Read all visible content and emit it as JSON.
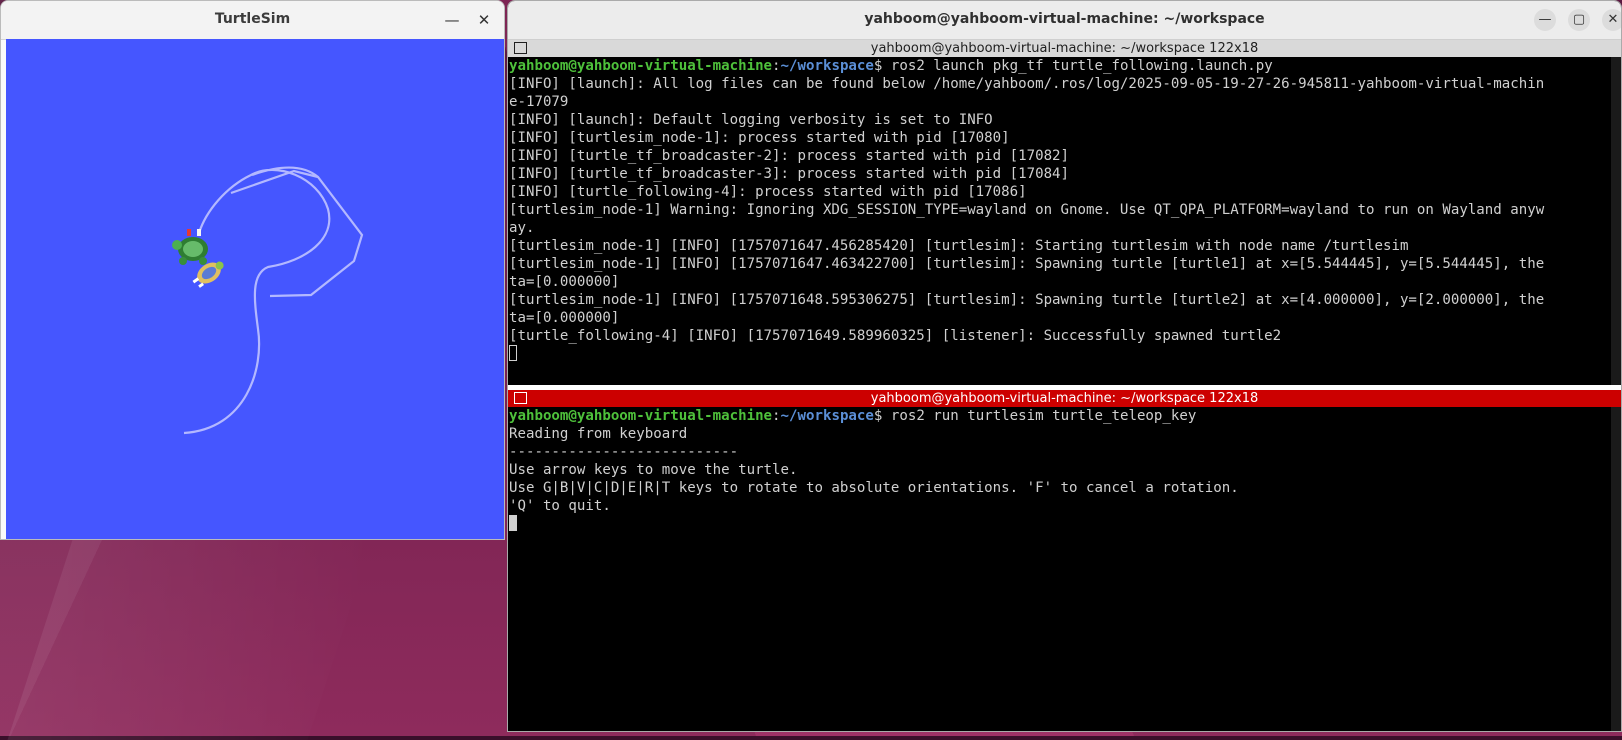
{
  "turtlesim": {
    "title": "TurtleSim",
    "minimize_glyph": "—",
    "close_glyph": "✕",
    "bg_color": "#4556ff",
    "trail_color": "#b3b8ff"
  },
  "terminal": {
    "window_title": "yahboom@yahboom-virtual-machine: ~/workspace",
    "minimize_glyph": "—",
    "maximize_glyph": "▢",
    "close_glyph": "✕",
    "pane1": {
      "header": "yahboom@yahboom-virtual-machine: ~/workspace 122x18",
      "prompt_user": "yahboom@yahboom-virtual-machine",
      "prompt_sep": ":",
      "prompt_path": "~/workspace",
      "prompt_dollar": "$ ",
      "command": "ros2 launch pkg_tf turtle_following.launch.py",
      "lines": [
        "[INFO] [launch]: All log files can be found below /home/yahboom/.ros/log/2025-09-05-19-27-26-945811-yahboom-virtual-machin",
        "e-17079",
        "[INFO] [launch]: Default logging verbosity is set to INFO",
        "[INFO] [turtlesim_node-1]: process started with pid [17080]",
        "[INFO] [turtle_tf_broadcaster-2]: process started with pid [17082]",
        "[INFO] [turtle_tf_broadcaster-3]: process started with pid [17084]",
        "[INFO] [turtle_following-4]: process started with pid [17086]",
        "[turtlesim_node-1] Warning: Ignoring XDG_SESSION_TYPE=wayland on Gnome. Use QT_QPA_PLATFORM=wayland to run on Wayland anyw",
        "ay.",
        "[turtlesim_node-1] [INFO] [1757071647.456285420] [turtlesim]: Starting turtlesim with node name /turtlesim",
        "[turtlesim_node-1] [INFO] [1757071647.463422700] [turtlesim]: Spawning turtle [turtle1] at x=[5.544445], y=[5.544445], the",
        "ta=[0.000000]",
        "[turtlesim_node-1] [INFO] [1757071648.595306275] [turtlesim]: Spawning turtle [turtle2] at x=[4.000000], y=[2.000000], the",
        "ta=[0.000000]",
        "[turtle_following-4] [INFO] [1757071649.589960325] [listener]: Successfully spawned turtle2"
      ]
    },
    "pane2": {
      "header": "yahboom@yahboom-virtual-machine: ~/workspace 122x18",
      "prompt_user": "yahboom@yahboom-virtual-machine",
      "prompt_sep": ":",
      "prompt_path": "~/workspace",
      "prompt_dollar": "$ ",
      "command": "ros2 run turtlesim turtle_teleop_key",
      "lines": [
        "Reading from keyboard",
        "---------------------------",
        "Use arrow keys to move the turtle.",
        "Use G|B|V|C|D|E|R|T keys to rotate to absolute orientations. 'F' to cancel a rotation.",
        "'Q' to quit."
      ]
    }
  }
}
